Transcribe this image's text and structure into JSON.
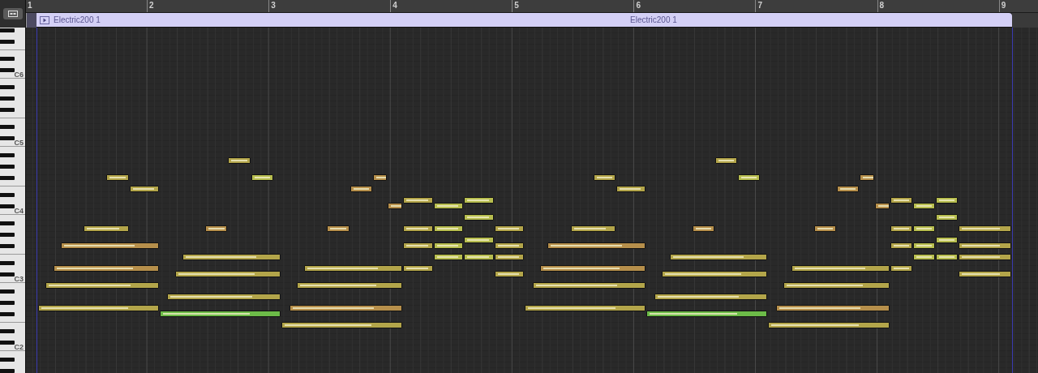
{
  "ruler": {
    "bars": [
      "1",
      "2",
      "3",
      "4",
      "5",
      "6",
      "7",
      "8",
      "9"
    ]
  },
  "region": {
    "labels": [
      "Electric200 1",
      "Electric200 1"
    ]
  },
  "keys": [
    {
      "kind": "black"
    },
    {
      "kind": "white"
    },
    {
      "kind": "black"
    },
    {
      "kind": "white"
    },
    {
      "kind": "white"
    },
    {
      "kind": "black"
    },
    {
      "kind": "white"
    },
    {
      "kind": "black"
    },
    {
      "kind": "white",
      "label": "C6"
    },
    {
      "kind": "white"
    },
    {
      "kind": "black"
    },
    {
      "kind": "white"
    },
    {
      "kind": "black"
    },
    {
      "kind": "white"
    },
    {
      "kind": "black"
    },
    {
      "kind": "white"
    },
    {
      "kind": "white"
    },
    {
      "kind": "black"
    },
    {
      "kind": "white"
    },
    {
      "kind": "black"
    },
    {
      "kind": "white",
      "label": "C5"
    },
    {
      "kind": "white"
    },
    {
      "kind": "black"
    },
    {
      "kind": "white",
      "notes": [
        {
          "color": "#b3a54a"
        },
        {
          "color": "#b3a54a"
        }
      ]
    },
    {
      "kind": "black"
    },
    {
      "kind": "white"
    },
    {
      "kind": "black",
      "notes": [
        {
          "color": "#b3a54a"
        },
        {
          "color": "#b7bd4f"
        },
        {
          "color": "#b68f4b"
        },
        {
          "color": "#b3a54a"
        },
        {
          "color": "#b7bd4f"
        },
        {
          "color": "#b68f4b"
        }
      ]
    },
    {
      "kind": "white"
    },
    {
      "kind": "white",
      "notes": [
        {
          "color": "#b3a54a"
        },
        {
          "color": "#b68f4b"
        },
        {
          "color": "#b3a54a"
        },
        {
          "color": "#b68f4b"
        }
      ]
    },
    {
      "kind": "black"
    },
    {
      "kind": "white",
      "notes": [
        {
          "color": "#b3a54a"
        },
        {
          "color": "#b7bd4f"
        },
        {
          "color": "#b3a54a"
        },
        {
          "color": "#b7bd4f"
        }
      ]
    },
    {
      "kind": "black",
      "notes": [
        {
          "color": "#b68f4b"
        },
        {
          "color": "#b7bd4f"
        },
        {
          "color": "#b68f4b"
        },
        {
          "color": "#b7bd4f"
        }
      ]
    },
    {
      "kind": "white",
      "label": "C4"
    },
    {
      "kind": "white",
      "notes": [
        {
          "color": "#b7bd4f"
        },
        {
          "color": "#b7bd4f"
        }
      ]
    },
    {
      "kind": "black"
    },
    {
      "kind": "white",
      "notes": [
        {
          "color": "#b3a54a"
        },
        {
          "color": "#b68f4b"
        },
        {
          "color": "#b68f4b"
        },
        {
          "color": "#b3a54a"
        },
        {
          "color": "#b7bd4f"
        },
        {
          "color": "#b3a54a"
        },
        {
          "color": "#b3a54a"
        },
        {
          "color": "#b68f4b"
        },
        {
          "color": "#b68f4b"
        },
        {
          "color": "#b3a54a"
        },
        {
          "color": "#b7bd4f"
        },
        {
          "color": "#b3a54a"
        }
      ]
    },
    {
      "kind": "black"
    },
    {
      "kind": "white",
      "notes": [
        {
          "color": "#b7bd4f"
        },
        {
          "color": "#b7bd4f"
        }
      ]
    },
    {
      "kind": "black",
      "notes": [
        {
          "color": "#b68f4b"
        },
        {
          "color": "#b3a54a"
        },
        {
          "color": "#b7bd4f"
        },
        {
          "color": "#b3a54a"
        },
        {
          "color": "#b68f4b"
        },
        {
          "color": "#b3a54a"
        },
        {
          "color": "#b7bd4f"
        },
        {
          "color": "#b3a54a"
        }
      ]
    },
    {
      "kind": "white"
    },
    {
      "kind": "white",
      "notes": [
        {
          "color": "#b3a54a"
        },
        {
          "color": "#b7bd4f"
        },
        {
          "color": "#b7bd4f"
        },
        {
          "color": "#b3a54a"
        },
        {
          "color": "#b3a54a"
        },
        {
          "color": "#b7bd4f"
        },
        {
          "color": "#b7bd4f"
        },
        {
          "color": "#b3a54a"
        }
      ]
    },
    {
      "kind": "black"
    },
    {
      "kind": "white",
      "notes": [
        {
          "color": "#b68f4b"
        },
        {
          "color": "#b3a54a"
        },
        {
          "color": "#b3a54a"
        },
        {
          "color": "#b68f4b"
        },
        {
          "color": "#b3a54a"
        },
        {
          "color": "#b3a54a"
        }
      ]
    },
    {
      "kind": "black",
      "notes": [
        {
          "color": "#b3a54a"
        },
        {
          "color": "#b3a54a"
        },
        {
          "color": "#b3a54a"
        },
        {
          "color": "#b3a54a"
        }
      ]
    },
    {
      "kind": "white",
      "label": "C3"
    },
    {
      "kind": "white",
      "notes": [
        {
          "color": "#b3a54a"
        },
        {
          "color": "#b3a54a"
        },
        {
          "color": "#b3a54a"
        },
        {
          "color": "#b3a54a"
        }
      ]
    },
    {
      "kind": "black"
    },
    {
      "kind": "white",
      "notes": [
        {
          "color": "#b3a54a"
        },
        {
          "color": "#b3a54a"
        }
      ]
    },
    {
      "kind": "black"
    },
    {
      "kind": "white",
      "notes": [
        {
          "color": "#b3a54a"
        },
        {
          "color": "#b68f4b"
        },
        {
          "color": "#b3a54a"
        },
        {
          "color": "#b68f4b"
        }
      ]
    },
    {
      "kind": "black",
      "notes": [
        {
          "color": "#6cbb48"
        },
        {
          "color": "#6cbb48"
        }
      ]
    },
    {
      "kind": "white"
    },
    {
      "kind": "white",
      "notes": [
        {
          "color": "#b3a54a"
        },
        {
          "color": "#b3a54a"
        }
      ]
    },
    {
      "kind": "black"
    },
    {
      "kind": "white"
    },
    {
      "kind": "black"
    },
    {
      "kind": "white",
      "label": "C2"
    },
    {
      "kind": "white"
    },
    {
      "kind": "black"
    },
    {
      "kind": "white"
    },
    {
      "kind": "black"
    }
  ]
}
